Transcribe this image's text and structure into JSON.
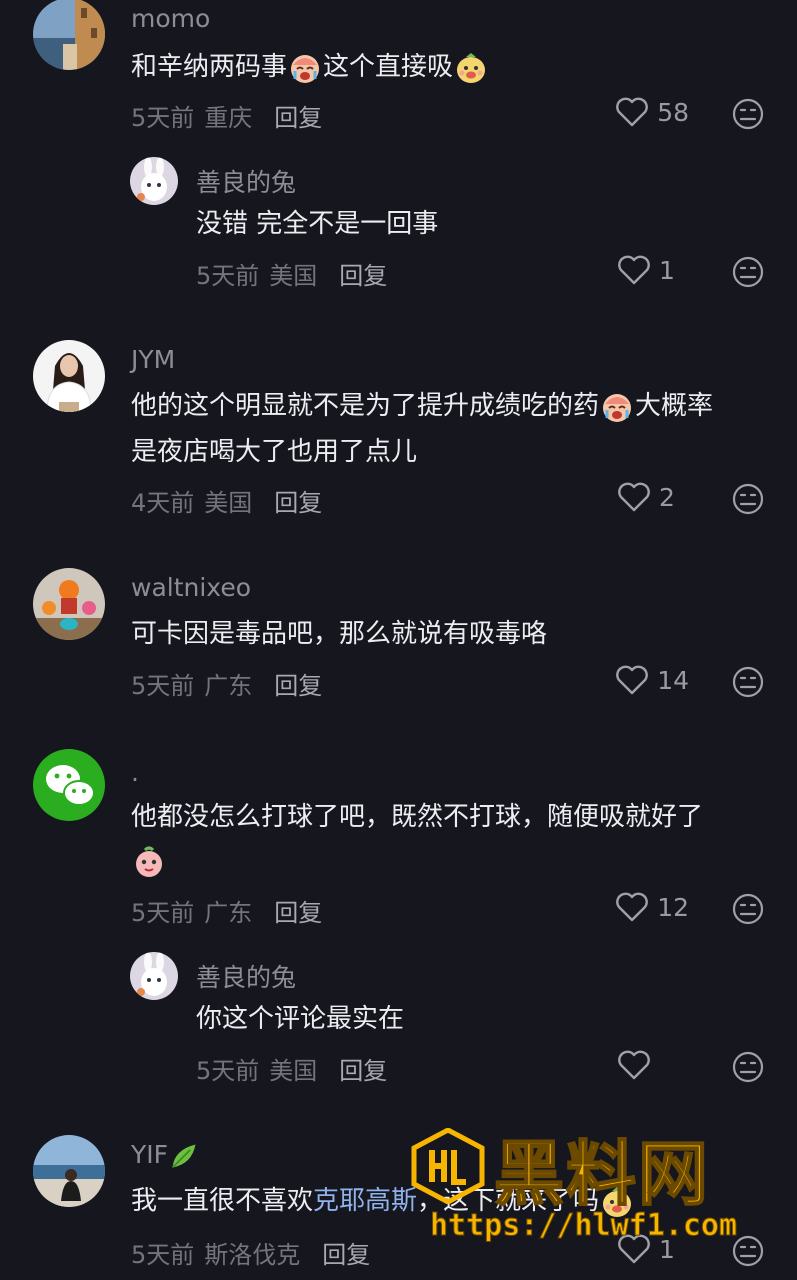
{
  "comments": [
    {
      "user": "momo",
      "text_a": "和辛纳两码事",
      "emoji_a": "crying-face-emoji",
      "text_b": "这个直接吸",
      "emoji_b": "dog-face-emoji",
      "time": "5天前",
      "location": "重庆",
      "reply": "回复",
      "likes": "58"
    },
    {
      "user": "善良的兔",
      "text": "没错 完全不是一回事",
      "time": "5天前",
      "location": "美国",
      "reply": "回复",
      "likes": "1"
    },
    {
      "user": "JYM",
      "text_a": "他的这个明显就不是为了提升成绩吃的药",
      "emoji_a": "crying-face-emoji",
      "text_b": "大概率",
      "text_line2": "是夜店喝大了也用了点儿",
      "time": "4天前",
      "location": "美国",
      "reply": "回复",
      "likes": "2"
    },
    {
      "user": "waltnixeo",
      "text": "可卡因是毒品吧，那么就说有吸毒咯",
      "time": "5天前",
      "location": "广东",
      "reply": "回复",
      "likes": "14"
    },
    {
      "user": ".",
      "text": "他都没怎么打球了吧，既然不打球，随便吸就好了",
      "emoji_line2": "peach-face-emoji",
      "time": "5天前",
      "location": "广东",
      "reply": "回复",
      "likes": "12"
    },
    {
      "user": "善良的兔",
      "text": "你这个评论最实在",
      "time": "5天前",
      "location": "美国",
      "reply": "回复",
      "likes": ""
    },
    {
      "user": "YIF",
      "user_badge": "leaf-icon",
      "text_a": "我一直很不喜欢",
      "mention": "克耶高斯",
      "text_b": "，这下就来了吗",
      "emoji_b": "dog-face-emoji",
      "time": "5天前",
      "location": "斯洛伐克",
      "reply": "回复",
      "likes": "1"
    }
  ],
  "watermark": {
    "title": "黑料网",
    "url": "https://hlwf1.com"
  },
  "colors": {
    "background": "#16161e",
    "username": "#8d8d96",
    "text": "#ececf1",
    "meta": "#74747d",
    "mention": "#8fb3ea",
    "watermark": "#f7b500"
  }
}
